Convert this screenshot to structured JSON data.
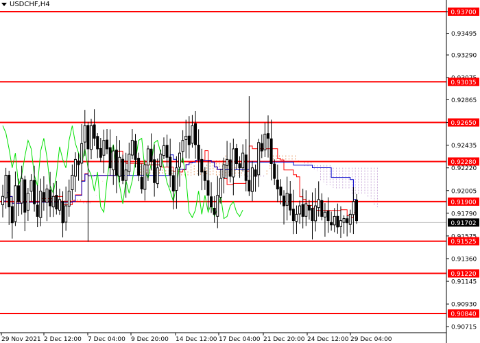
{
  "chart": {
    "symbol": "USDCHF,H4",
    "colors": {
      "background": "#ffffff",
      "axis": "#000000",
      "levels": "#ff0000",
      "current_line": "#c0c0c0",
      "current_box": "#000000",
      "tenkan": "#ff0000",
      "kijun": "#0000cc",
      "chikou": "#00e000",
      "cloud_bull": "#e8a070",
      "cloud_bear": "#c8a8d8",
      "candles": "#000000"
    }
  },
  "chart_data": {
    "type": "candlestick",
    "title": "USDCHF,H4",
    "ylim": [
      0.9067,
      0.9382
    ],
    "y_ticks": [
      "0.93700",
      "0.93495",
      "0.93290",
      "0.93075",
      "0.92865",
      "0.92650",
      "0.92435",
      "0.92220",
      "0.92005",
      "0.91790",
      "0.91575",
      "0.91360",
      "0.91145",
      "0.90930",
      "0.90715"
    ],
    "x_labels": [
      "29 Nov 2021",
      "2 Dec 12:00",
      "7 Dec 04:00",
      "9 Dec 20:00",
      "14 Dec 12:00",
      "17 Dec 04:00",
      "21 Dec 20:00",
      "24 Dec 12:00",
      "29 Dec 04:00"
    ],
    "levels": [
      "0.93700",
      "0.93035",
      "0.92650",
      "0.92280",
      "0.91900",
      "0.91525",
      "0.91220",
      "0.90840"
    ],
    "current_price": "0.91702",
    "closes": [
      0.9195,
      0.9215,
      0.9185,
      0.917,
      0.9205,
      0.919,
      0.9212,
      0.918,
      0.9198,
      0.921,
      0.9188,
      0.9176,
      0.92,
      0.919,
      0.9202,
      0.9186,
      0.9195,
      0.9183,
      0.9192,
      0.917,
      0.9186,
      0.92,
      0.9215,
      0.923,
      0.9225,
      0.9245,
      0.9262,
      0.924,
      0.9262,
      0.925,
      0.924,
      0.9232,
      0.9248,
      0.924,
      0.9222,
      0.9238,
      0.9215,
      0.9232,
      0.921,
      0.922,
      0.9235,
      0.9248,
      0.923,
      0.9215,
      0.9202,
      0.9225,
      0.924,
      0.9228,
      0.9208,
      0.9222,
      0.9235,
      0.9243,
      0.9232,
      0.9215,
      0.92,
      0.9222,
      0.9236,
      0.9248,
      0.9252,
      0.9244,
      0.9262,
      0.9244,
      0.923,
      0.9218,
      0.921,
      0.9196,
      0.9185,
      0.9178,
      0.9196,
      0.9212,
      0.9225,
      0.923,
      0.9214,
      0.924,
      0.9226,
      0.9222,
      0.9236,
      0.921,
      0.92,
      0.9222,
      0.9214,
      0.9246,
      0.9238,
      0.9254,
      0.925,
      0.9226,
      0.9212,
      0.9202,
      0.9196,
      0.9186,
      0.9198,
      0.9182,
      0.9172,
      0.9178,
      0.9186,
      0.9176,
      0.9188,
      0.9182,
      0.9172,
      0.9186,
      0.9192,
      0.9176,
      0.918,
      0.9172,
      0.9168,
      0.9176,
      0.9166,
      0.9172,
      0.9174,
      0.917,
      0.9178,
      0.919,
      0.9172
    ],
    "chikou": [
      0.9262,
      0.9255,
      0.924,
      0.9222,
      0.9236,
      0.9205,
      0.9215,
      0.9233,
      0.9248,
      0.924,
      0.9215,
      0.9205,
      0.9238,
      0.925,
      0.9232,
      0.9205,
      0.9198,
      0.9215,
      0.9242,
      0.923,
      0.9222,
      0.9248,
      0.9262,
      0.9245,
      0.9236,
      0.9226,
      0.924,
      0.9222,
      0.9215,
      0.92,
      0.9218,
      0.9185,
      0.918,
      0.921,
      0.9232,
      0.9244,
      0.9222,
      0.9205,
      0.9188,
      0.921,
      0.9198,
      0.921,
      0.9228,
      0.9248,
      0.925,
      0.922,
      0.9212,
      0.9226,
      0.9246,
      0.9248,
      0.9236,
      0.9222,
      0.9208,
      0.92,
      0.919,
      0.9206,
      0.9224,
      0.9232,
      0.9212,
      0.918,
      0.9175,
      0.9182,
      0.92,
      0.9178,
      0.9196,
      0.918,
      0.9188,
      0.9176,
      0.9184,
      0.9195,
      0.9174,
      0.9176,
      0.9186,
      0.919,
      0.918,
      0.9176,
      0.9182
    ]
  }
}
